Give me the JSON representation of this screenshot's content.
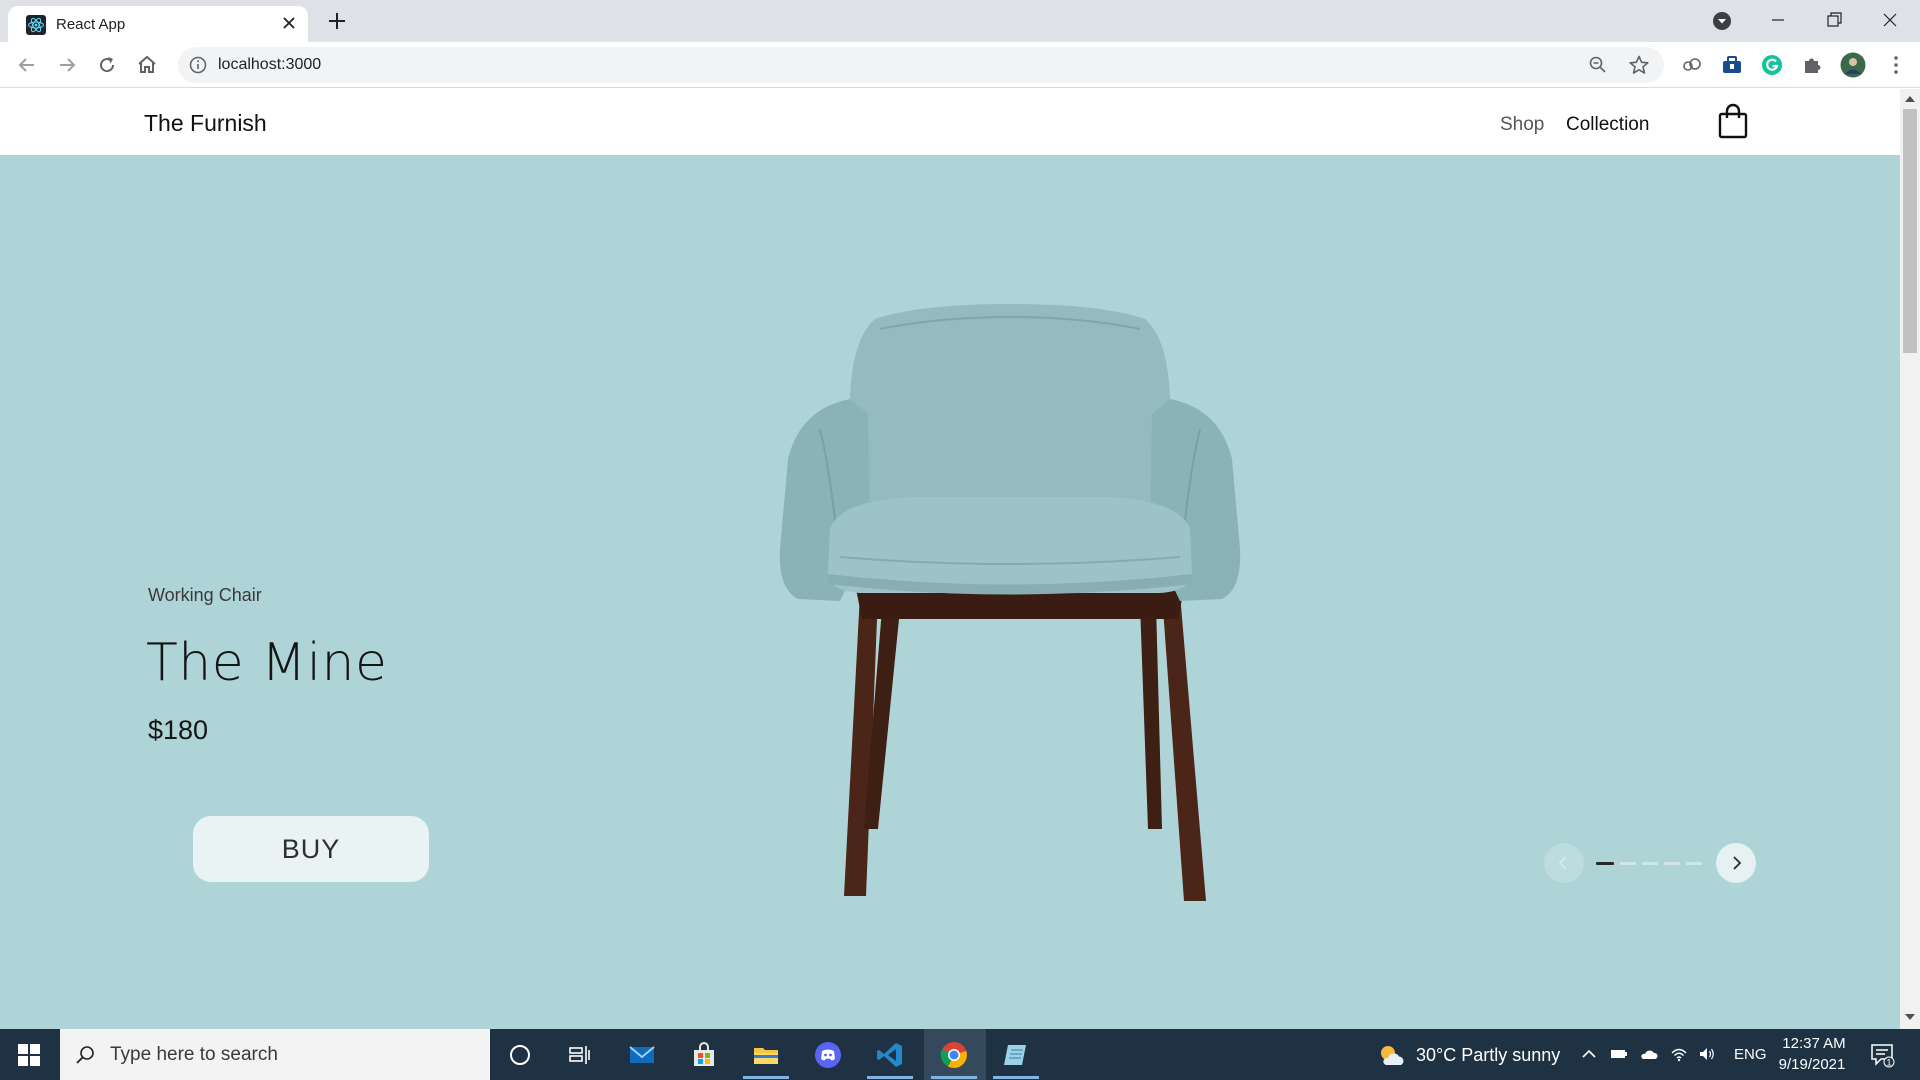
{
  "browser": {
    "tab_title": "React App",
    "url": "localhost:3000"
  },
  "site": {
    "brand": "The Furnish",
    "nav": {
      "shop": "Shop",
      "collection": "Collection"
    },
    "hero": {
      "category": "Working Chair",
      "name": "The Mine",
      "price": "$180",
      "buy_label": "BUY",
      "carousel": {
        "active_slide": 1,
        "total_slides": 5
      }
    },
    "colors": {
      "hero_background": "#aed4d8",
      "button_background": "#e9f3f4",
      "chair_fabric": "#8fb8bd",
      "chair_legs": "#4a2518"
    }
  },
  "taskbar": {
    "search_placeholder": "Type here to search",
    "weather": "30°C  Partly sunny",
    "language": "ENG",
    "time": "12:37 AM",
    "date": "9/19/2021",
    "notification_count": "1"
  }
}
